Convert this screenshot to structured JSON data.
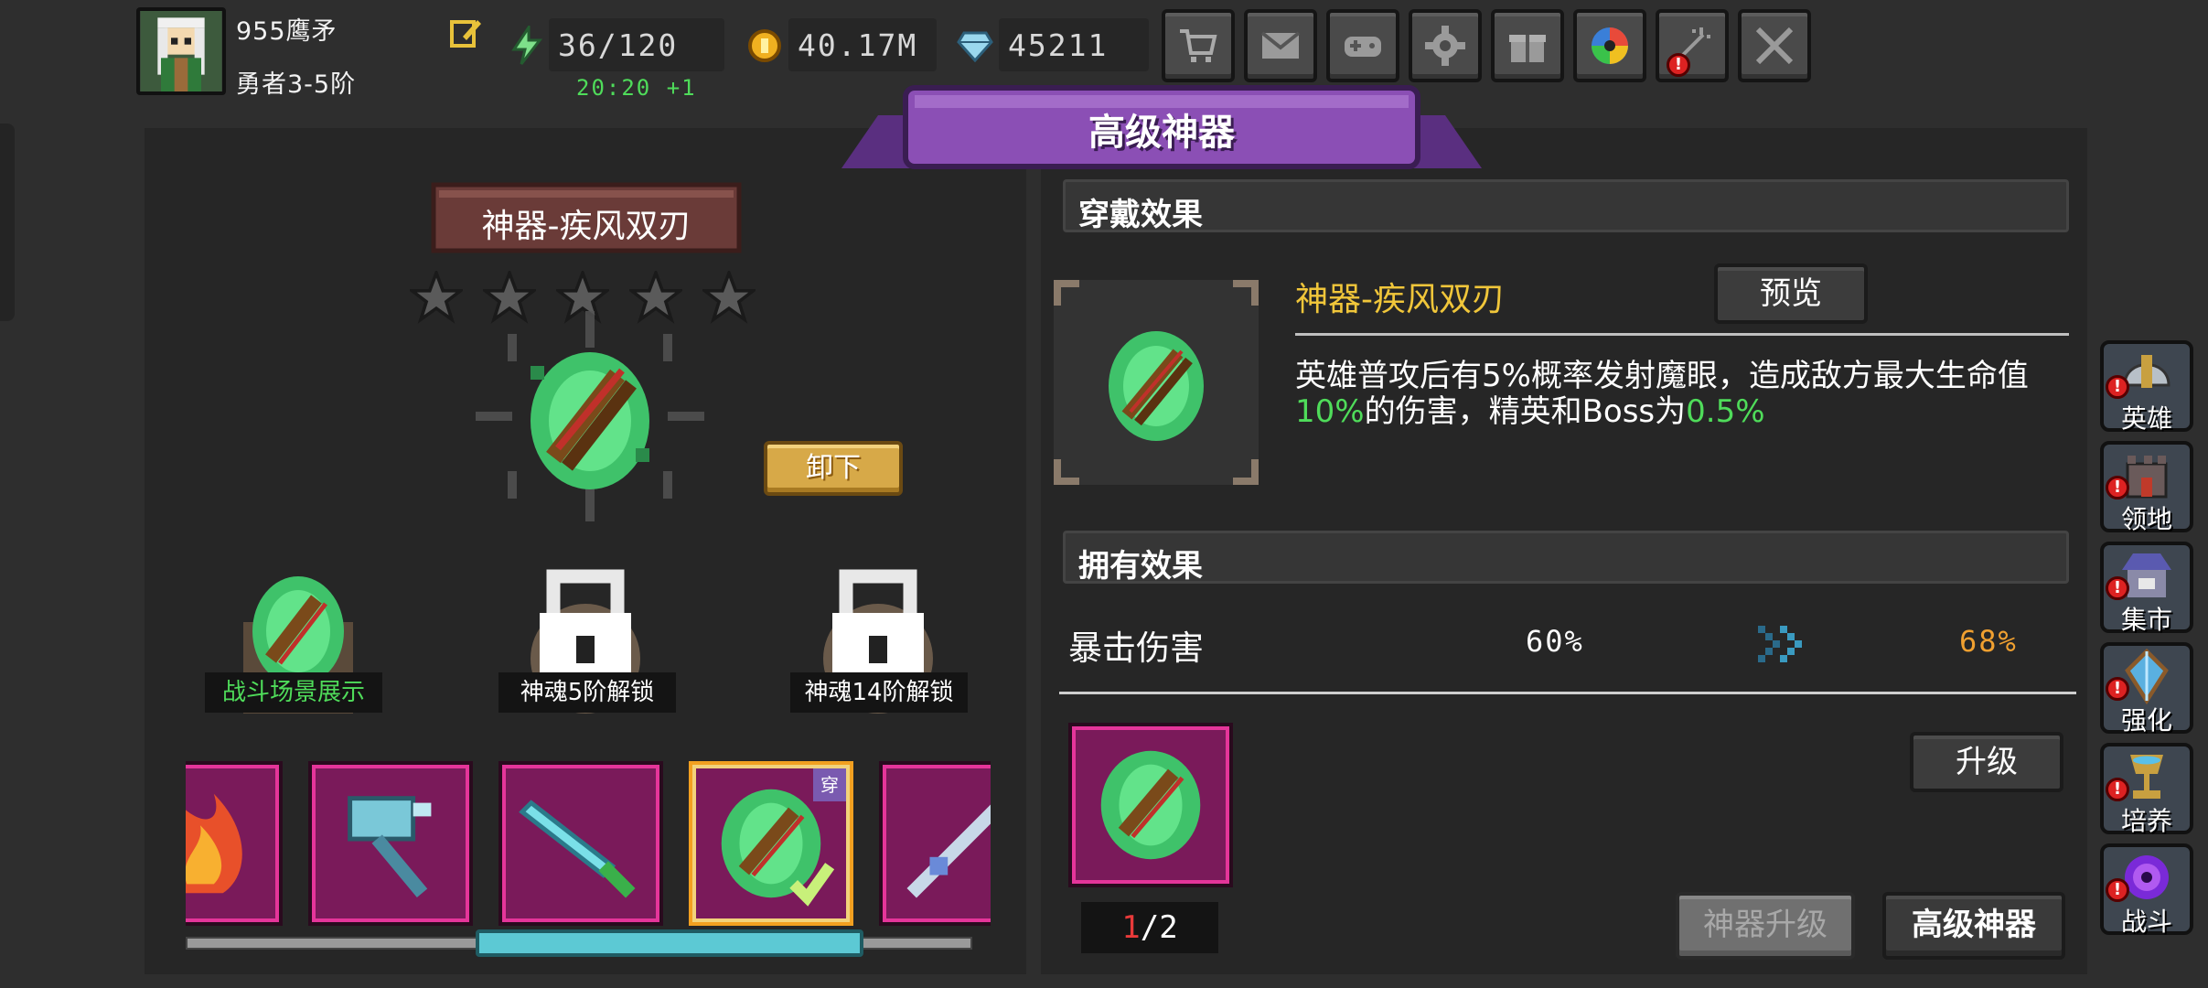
{
  "player": {
    "name": "955鹰矛",
    "rank": "勇者3-5阶"
  },
  "resources": {
    "energy": "36/120",
    "energy_timer": "20:20 +1",
    "gold": "40.17M",
    "diamond": "45211"
  },
  "top_buttons": [
    "cart-icon",
    "mail-icon",
    "gamepad-icon",
    "gear-icon",
    "gift-icon",
    "aperture-icon",
    "sword-burst-icon",
    "crossed-swords-icon"
  ],
  "banner": {
    "title": "高级神器"
  },
  "artifact": {
    "name": "神器-疾风双刃",
    "stars_total": 5,
    "stars_filled": 0,
    "unequip_label": "卸下"
  },
  "skins": [
    {
      "label": "战斗场景展示",
      "locked": false,
      "color": "#4fdc5a"
    },
    {
      "label": "神魂5阶解锁",
      "locked": true,
      "color": "#ffffff"
    },
    {
      "label": "神魂14阶解锁",
      "locked": true,
      "color": "#ffffff"
    }
  ],
  "carousel": {
    "items": [
      "fire-artifact",
      "hammer-artifact",
      "blade-artifact",
      "twin-blades-artifact",
      "spear-artifact"
    ],
    "equipped_badge": "穿"
  },
  "wear_effect": {
    "header": "穿戴效果",
    "item_name": "神器-疾风双刃",
    "preview_label": "预览",
    "desc_part1": "英雄普攻后有5%概率发射魔眼，造成敌方最大生命值",
    "desc_val1": "10%",
    "desc_part2": "的伤害，精英和Boss为",
    "desc_val2": "0.5%"
  },
  "own_effect": {
    "header": "拥有效果",
    "stat_name": "暴击伤害",
    "current": "60%",
    "next": "68%"
  },
  "material": {
    "have": "1",
    "need": "/2",
    "upgrade_label": "升级"
  },
  "bottom_buttons": {
    "artifact_upgrade": "神器升级",
    "advanced_artifact": "高级神器"
  },
  "side_menu": [
    {
      "label": "英雄",
      "icon": "helmet-icon"
    },
    {
      "label": "领地",
      "icon": "castle-icon"
    },
    {
      "label": "集市",
      "icon": "market-icon"
    },
    {
      "label": "强化",
      "icon": "crystal-icon"
    },
    {
      "label": "培养",
      "icon": "chalice-icon"
    },
    {
      "label": "战斗",
      "icon": "portal-icon"
    }
  ],
  "colors": {
    "accent_purple": "#8b4fb5",
    "gold_text": "#f0c63a",
    "green_text": "#4fdc5a",
    "orange_text": "#f0a030"
  }
}
